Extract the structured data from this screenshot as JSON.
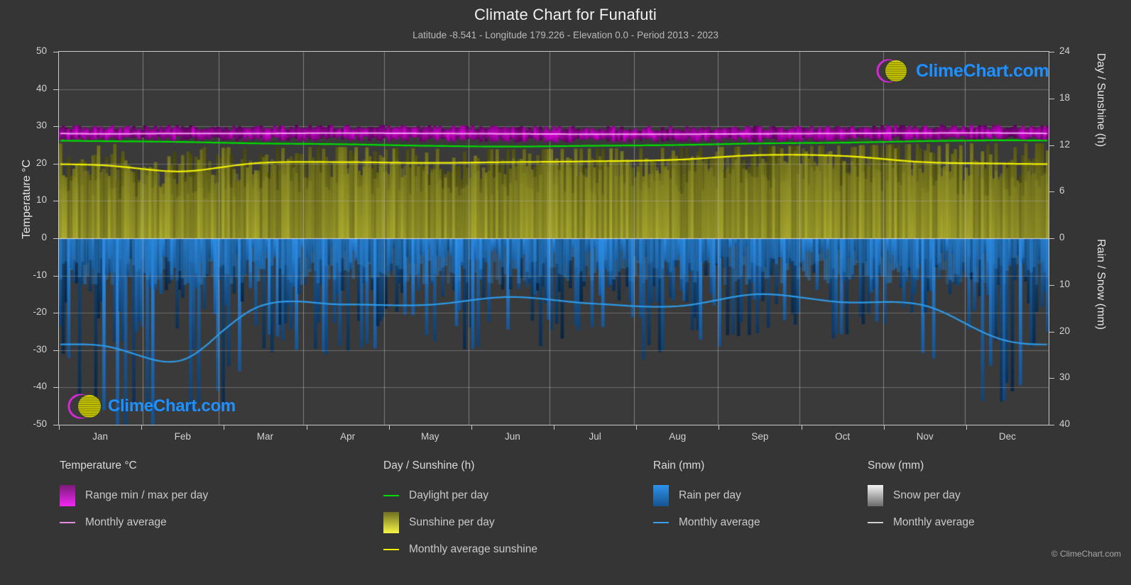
{
  "header": {
    "title": "Climate Chart for Funafuti",
    "subtitle": "Latitude -8.541 - Longitude 179.226 - Elevation 0.0 - Period 2013 - 2023"
  },
  "branding": {
    "logo_text": "ClimeChart.com",
    "copyright": "© ClimeChart.com",
    "logo_color": "#1e90ff",
    "ring_color": "#d629d6",
    "sphere_color": "#d4d400"
  },
  "axes": {
    "left_title": "Temperature °C",
    "left_ticks": [
      50,
      40,
      30,
      20,
      10,
      0,
      -10,
      -20,
      -30,
      -40,
      -50
    ],
    "right_top_title": "Day / Sunshine (h)",
    "right_top_ticks": [
      24,
      18,
      12,
      6,
      0
    ],
    "right_bottom_title": "Rain / Snow (mm)",
    "right_bottom_ticks": [
      0,
      10,
      20,
      30,
      40
    ],
    "x_ticks": [
      "Jan",
      "Feb",
      "Mar",
      "Apr",
      "May",
      "Jun",
      "Jul",
      "Aug",
      "Sep",
      "Oct",
      "Nov",
      "Dec"
    ]
  },
  "legend": {
    "columns": [
      {
        "title": "Temperature °C",
        "items": [
          {
            "label": "Range min / max per day",
            "swatch": "box",
            "color": "#e400e4",
            "name": "temp-range-swatch"
          },
          {
            "label": "Monthly average",
            "swatch": "line",
            "color": "#e48ce4",
            "name": "temp-average-swatch"
          }
        ]
      },
      {
        "title": "Day / Sunshine (h)",
        "items": [
          {
            "label": "Daylight per day",
            "swatch": "line",
            "color": "#00dd00",
            "name": "daylight-swatch"
          },
          {
            "label": "Sunshine per day",
            "swatch": "box",
            "color": "#f2f233",
            "name": "sunshine-swatch"
          },
          {
            "label": "Monthly average sunshine",
            "swatch": "line",
            "color": "#f0f000",
            "name": "sunshine-average-swatch"
          }
        ]
      },
      {
        "title": "Rain (mm)",
        "items": [
          {
            "label": "Rain per day",
            "swatch": "box",
            "color": "#1e90ff",
            "name": "rain-swatch"
          },
          {
            "label": "Monthly average",
            "swatch": "line",
            "color": "#3aa0ee",
            "name": "rain-average-swatch"
          }
        ]
      },
      {
        "title": "Snow (mm)",
        "items": [
          {
            "label": "Snow per day",
            "swatch": "box",
            "color": "#e8e8e8",
            "name": "snow-swatch"
          },
          {
            "label": "Monthly average",
            "swatch": "line",
            "color": "#d0d0d0",
            "name": "snow-average-swatch"
          }
        ]
      }
    ]
  },
  "chart_data": {
    "type": "area",
    "title": "Climate Chart for Funafuti",
    "subtitle": "Latitude -8.541 - Longitude 179.226 - Elevation 0.0 - Period 2013 - 2023",
    "xlabel": "",
    "ylabel": "Temperature °C",
    "ylim": [
      -50,
      50
    ],
    "y2lim_sunshine": [
      0,
      24
    ],
    "y2lim_rain": [
      0,
      40
    ],
    "grid": true,
    "legend_position": "below",
    "categories": [
      "Jan",
      "Feb",
      "Mar",
      "Apr",
      "May",
      "Jun",
      "Jul",
      "Aug",
      "Sep",
      "Oct",
      "Nov",
      "Dec"
    ],
    "series": [
      {
        "name": "Temperature monthly average",
        "unit": "°C",
        "color": "#e48ce4",
        "values": [
          28.0,
          28.1,
          28.1,
          28.2,
          28.1,
          28.0,
          27.9,
          27.9,
          28.0,
          28.1,
          28.2,
          28.2
        ]
      },
      {
        "name": "Temperature daily max (range top)",
        "unit": "°C",
        "color": "#e400e4",
        "values": [
          29.6,
          29.7,
          29.7,
          29.8,
          29.7,
          29.5,
          29.4,
          29.4,
          29.5,
          29.7,
          29.8,
          29.8
        ]
      },
      {
        "name": "Temperature daily min (range bottom)",
        "unit": "°C",
        "color": "#e400e4",
        "values": [
          26.6,
          26.7,
          26.6,
          26.7,
          26.6,
          26.4,
          26.3,
          26.3,
          26.4,
          26.6,
          26.7,
          26.8
        ]
      },
      {
        "name": "Daylight per day",
        "unit": "h",
        "color": "#00dd00",
        "values": [
          12.5,
          12.4,
          12.2,
          12.1,
          11.9,
          11.8,
          11.9,
          12.0,
          12.2,
          12.3,
          12.5,
          12.6
        ]
      },
      {
        "name": "Monthly average sunshine",
        "unit": "h",
        "color": "#f0f000",
        "values": [
          9.4,
          8.6,
          9.7,
          9.8,
          9.7,
          9.8,
          9.9,
          10.1,
          10.7,
          10.6,
          9.8,
          9.6
        ]
      },
      {
        "name": "Rain monthly average",
        "unit": "mm",
        "color": "#3aa0ee",
        "values": [
          23.0,
          26.2,
          14.5,
          14.2,
          14.3,
          12.6,
          14.0,
          14.6,
          12.0,
          13.7,
          14.4,
          22.0
        ]
      },
      {
        "name": "Snow monthly average",
        "unit": "mm",
        "color": "#d0d0d0",
        "values": [
          0,
          0,
          0,
          0,
          0,
          0,
          0,
          0,
          0,
          0,
          0,
          0
        ]
      }
    ]
  }
}
